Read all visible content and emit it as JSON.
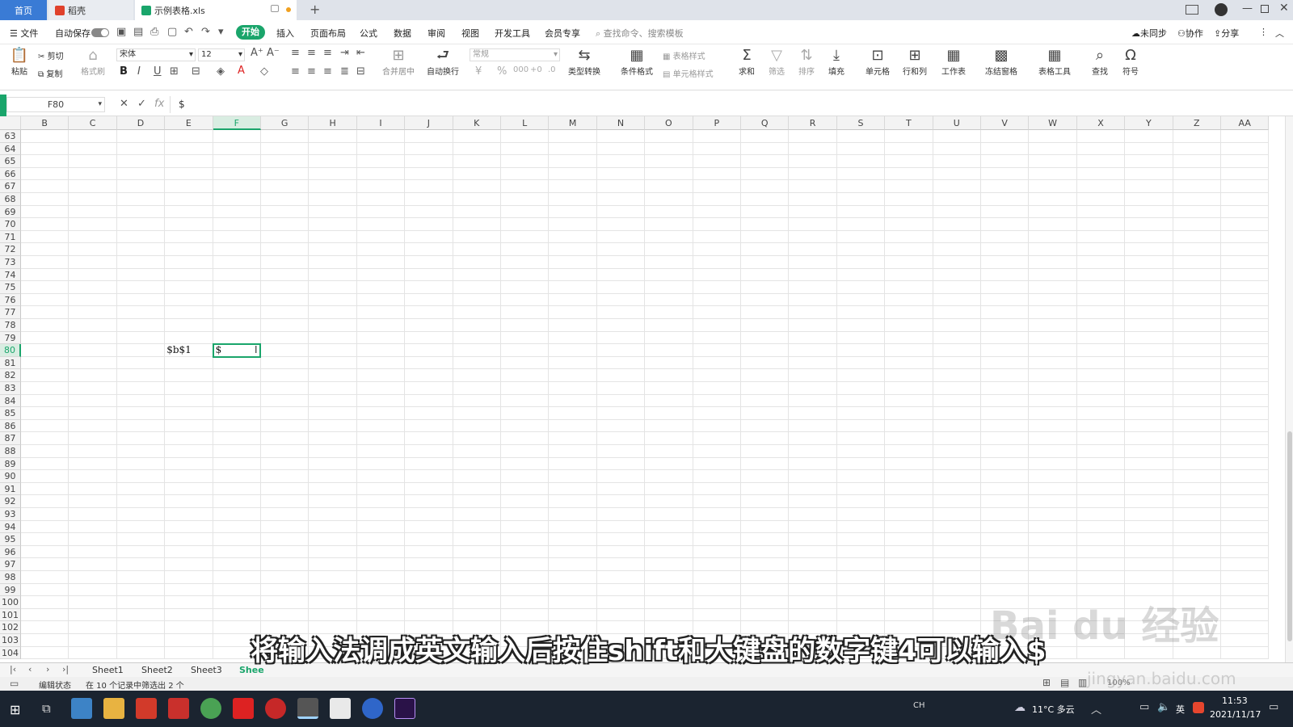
{
  "tabs": [
    {
      "label": "首页",
      "active": false
    },
    {
      "label": "稻壳",
      "active": false
    },
    {
      "label": "示例表格.xls",
      "active": true
    }
  ],
  "menu": {
    "file_label": "文件",
    "autosave_label": "自动保存",
    "items": [
      "开始",
      "插入",
      "页面布局",
      "公式",
      "数据",
      "审阅",
      "视图",
      "开发工具",
      "会员专享"
    ],
    "search_placeholder": "查找命令、搜索模板",
    "right": [
      "未同步",
      "协作",
      "分享"
    ]
  },
  "toolbar": {
    "paste": "粘贴",
    "cut": "剪切",
    "copy": "复制",
    "format_painter": "格式刷",
    "font_name": "宋体",
    "font_size": "12",
    "merge": "合并居中",
    "wrap": "自动换行",
    "number_format": "常规",
    "type_convert": "类型转换",
    "cond_format": "条件格式",
    "table_style": "表格样式",
    "cell_style": "单元格样式",
    "sum": "求和",
    "filter": "筛选",
    "sort": "排序",
    "fill": "填充",
    "cell": "单元格",
    "rowcol": "行和列",
    "worksheet": "工作表",
    "freeze": "冻结窗格",
    "table_tools": "表格工具",
    "find": "查找",
    "symbol": "符号"
  },
  "formula_bar": {
    "name_box": "F80",
    "fx": "fx",
    "content": "$"
  },
  "grid": {
    "columns": [
      "B",
      "C",
      "D",
      "E",
      "F",
      "G",
      "H",
      "I",
      "J",
      "K",
      "L",
      "M",
      "N",
      "O",
      "P",
      "Q",
      "R",
      "S",
      "T",
      "U",
      "V",
      "W",
      "X",
      "Y",
      "Z",
      "AA"
    ],
    "active_column": "F",
    "rows": [
      "63",
      "64",
      "65",
      "66",
      "67",
      "68",
      "69",
      "70",
      "71",
      "72",
      "73",
      "74",
      "75",
      "76",
      "77",
      "78",
      "79",
      "80",
      "81",
      "82",
      "83",
      "84",
      "85",
      "86",
      "87",
      "88",
      "89",
      "90",
      "91",
      "92",
      "93",
      "94",
      "95",
      "96",
      "97",
      "98",
      "99",
      "100",
      "101",
      "102",
      "103",
      "104"
    ],
    "active_row": "80",
    "cell_e80": "$b$1",
    "cell_f80": "$"
  },
  "sheets": [
    "Sheet1",
    "Sheet2",
    "Sheet3",
    "Shee"
  ],
  "status": {
    "mode": "编辑状态",
    "filter_info": "在 10 个记录中筛选出 2 个",
    "zoom": "100%"
  },
  "subtitle": "将输入法调成英文输入后按住shift和大键盘的数字键4可以输入$",
  "watermark": "Bai du 经验",
  "watermark_url": "jingyan.baidu.com",
  "taskbar": {
    "weather": "11°C 多云",
    "ime1": "英",
    "time": "11:53",
    "date": "2021/11/17"
  },
  "colors": {
    "accent_green": "#1aa56b",
    "tab_home": "#3a7bd5",
    "subtitle_text": "#ffffff"
  }
}
